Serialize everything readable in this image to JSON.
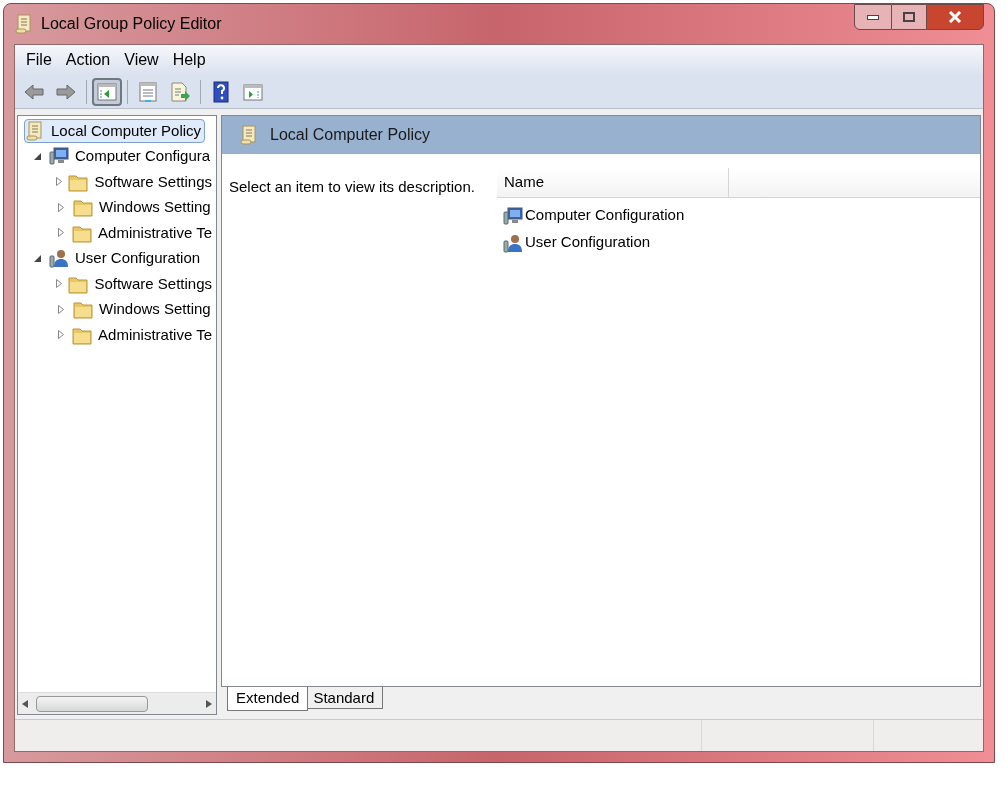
{
  "window": {
    "title": "Local Group Policy Editor"
  },
  "menu": [
    "File",
    "Action",
    "View",
    "Help"
  ],
  "toolbar": [
    {
      "kind": "back",
      "pressed": false
    },
    {
      "kind": "forward",
      "pressed": false
    },
    {
      "kind": "separator"
    },
    {
      "kind": "tree",
      "pressed": true
    },
    {
      "kind": "separator"
    },
    {
      "kind": "properties",
      "pressed": false
    },
    {
      "kind": "export",
      "pressed": false
    },
    {
      "kind": "separator"
    },
    {
      "kind": "help",
      "pressed": false
    },
    {
      "kind": "action-pane",
      "pressed": false
    }
  ],
  "tree": [
    {
      "label": "Local Computer Policy",
      "kind": "scroll",
      "selected": true,
      "children": [
        {
          "label": "Computer Configura",
          "kind": "computer",
          "expanded": true,
          "selected": false,
          "children": [
            {
              "label": "Software Settings",
              "kind": "folder",
              "expanded": false,
              "selected": false
            },
            {
              "label": "Windows Setting",
              "kind": "folder",
              "expanded": false,
              "selected": false
            },
            {
              "label": "Administrative Te",
              "kind": "folder",
              "expanded": false,
              "selected": false
            }
          ]
        },
        {
          "label": "User Configuration",
          "kind": "user",
          "expanded": true,
          "selected": false,
          "children": [
            {
              "label": "Software Settings",
              "kind": "folder",
              "expanded": false,
              "selected": false
            },
            {
              "label": "Windows Setting",
              "kind": "folder",
              "expanded": false,
              "selected": false
            },
            {
              "label": "Administrative Te",
              "kind": "folder",
              "expanded": false,
              "selected": false
            }
          ]
        }
      ]
    }
  ],
  "details": {
    "title": "Local Computer Policy",
    "description": "Select an item to view its description.",
    "columns": [
      "Name"
    ],
    "rows": [
      {
        "name": "Computer Configuration",
        "kind": "computer"
      },
      {
        "name": "User Configuration",
        "kind": "user"
      }
    ]
  },
  "tabs": [
    {
      "label": "Extended",
      "selected": true
    },
    {
      "label": "Standard",
      "selected": false
    }
  ]
}
